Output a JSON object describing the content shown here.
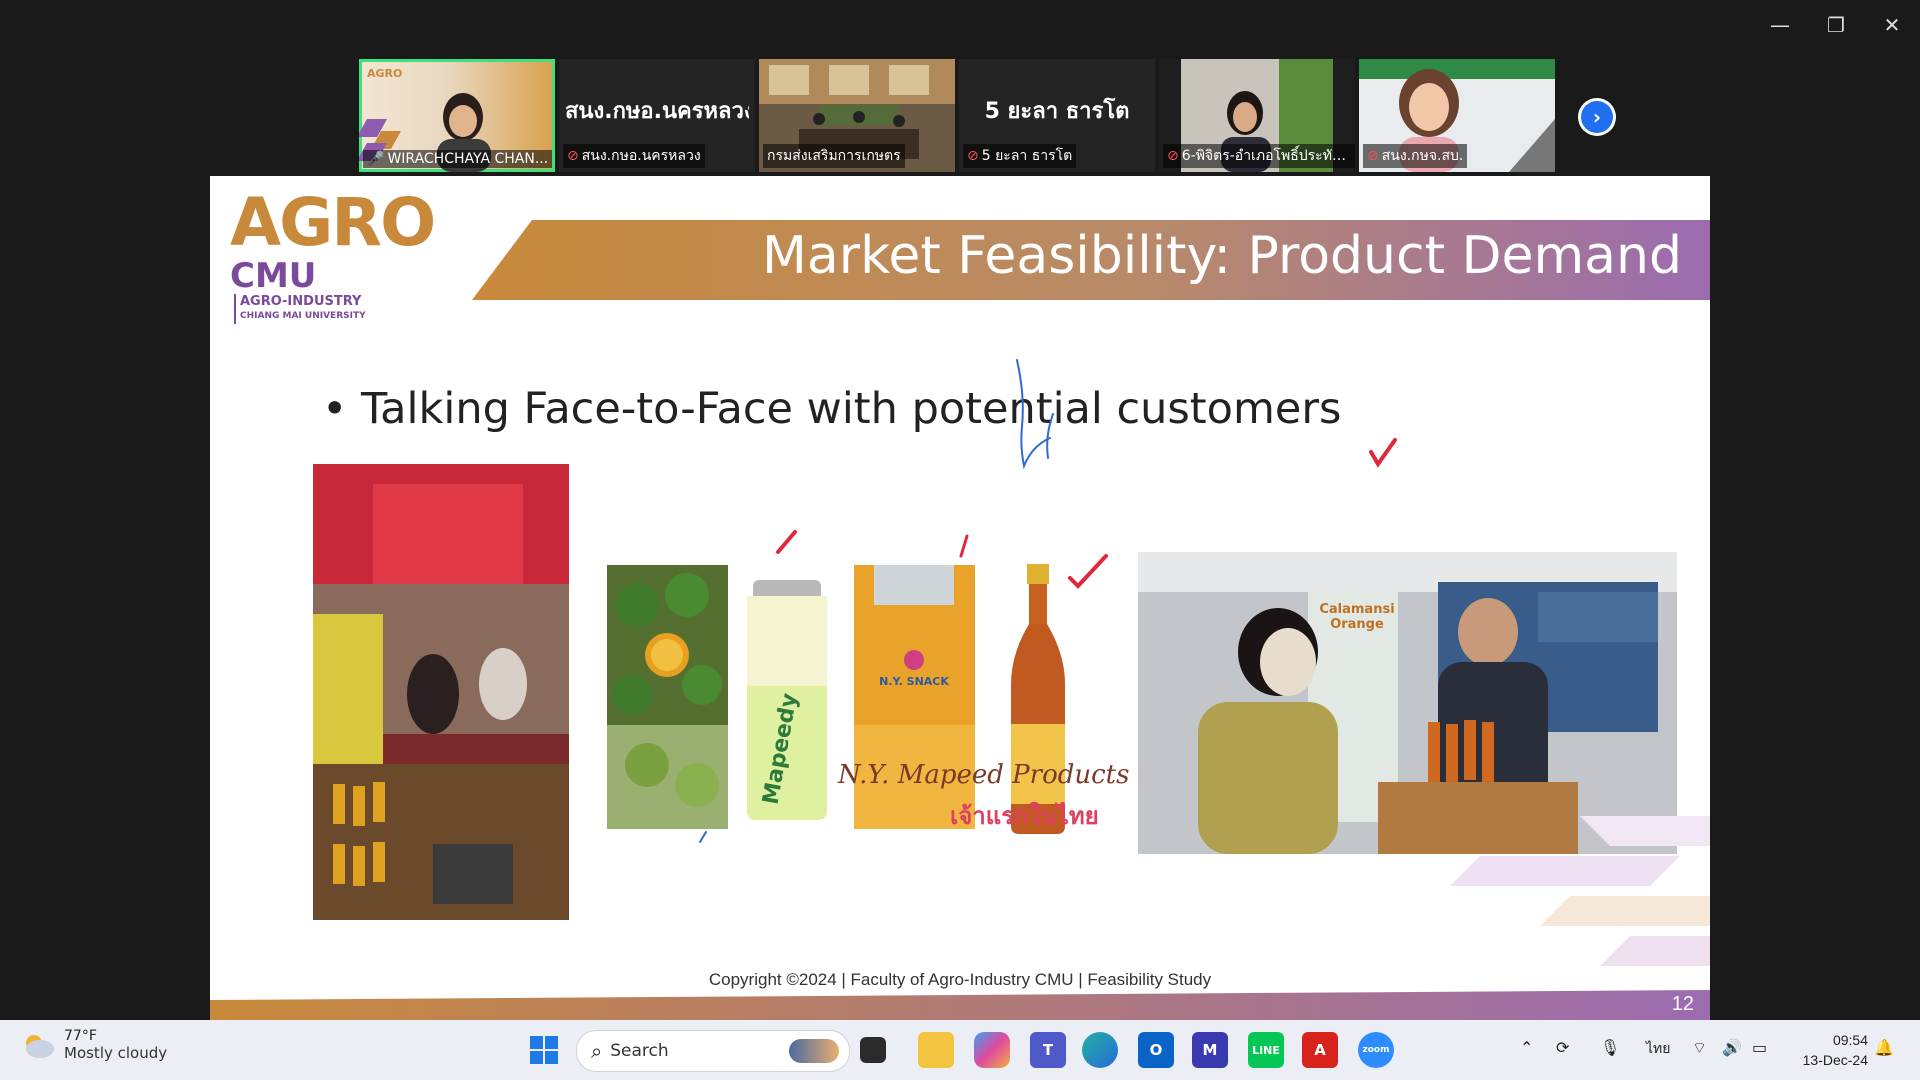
{
  "window_controls": {
    "minimize": "—",
    "restore": "❐",
    "close": "✕"
  },
  "participants": [
    {
      "name": "WIRACHCHAYA CHAN...",
      "big": "",
      "mic": "active"
    },
    {
      "name": "สนง.กษอ.นครหลวง",
      "big": "สนง.กษอ.นครหลวง",
      "mic": "muted"
    },
    {
      "name": "กรมส่งเสริมการเกษตร",
      "big": "",
      "mic": "none"
    },
    {
      "name": "5 ยะลา ธารโต",
      "big": "5 ยะลา ธารโต",
      "mic": "muted"
    },
    {
      "name": "6-พิจิตร-อำเภอโพธิ์ประทับ...",
      "big": "",
      "mic": "muted"
    },
    {
      "name": "สนง.กษจ.สบ.",
      "big": "",
      "mic": "muted"
    }
  ],
  "slide": {
    "logo_agro": "AGRO",
    "logo_cmu": "CMU",
    "logo_sub1": "AGRO-INDUSTRY",
    "logo_sub2": "CHIANG MAI UNIVERSITY",
    "title": "Market Feasibility: Product Demand",
    "bullet": "• Talking Face-to-Face with potential customers",
    "products_caption": "N.Y. Mapeed Products",
    "products_caption_th": "เจ้าแรกในไทย",
    "can_label": "Mapeedy",
    "pouch_label": "N.Y. SNACK",
    "booth_sign": "Calamansi Orange",
    "footer": "Copyright ©2024 | Faculty of Agro-Industry CMU | Feasibility Study",
    "page_number": "12"
  },
  "colors": {
    "gold": "#c8893a",
    "purple": "#9b6cb0",
    "active_border": "#3ee07d",
    "zoom_blue": "#1f6ff0"
  },
  "taskbar": {
    "temperature": "77°F",
    "weather": "Mostly cloudy",
    "search_label": "Search",
    "language": "ไทย",
    "time": "09:54",
    "date": "13-Dec-24"
  }
}
